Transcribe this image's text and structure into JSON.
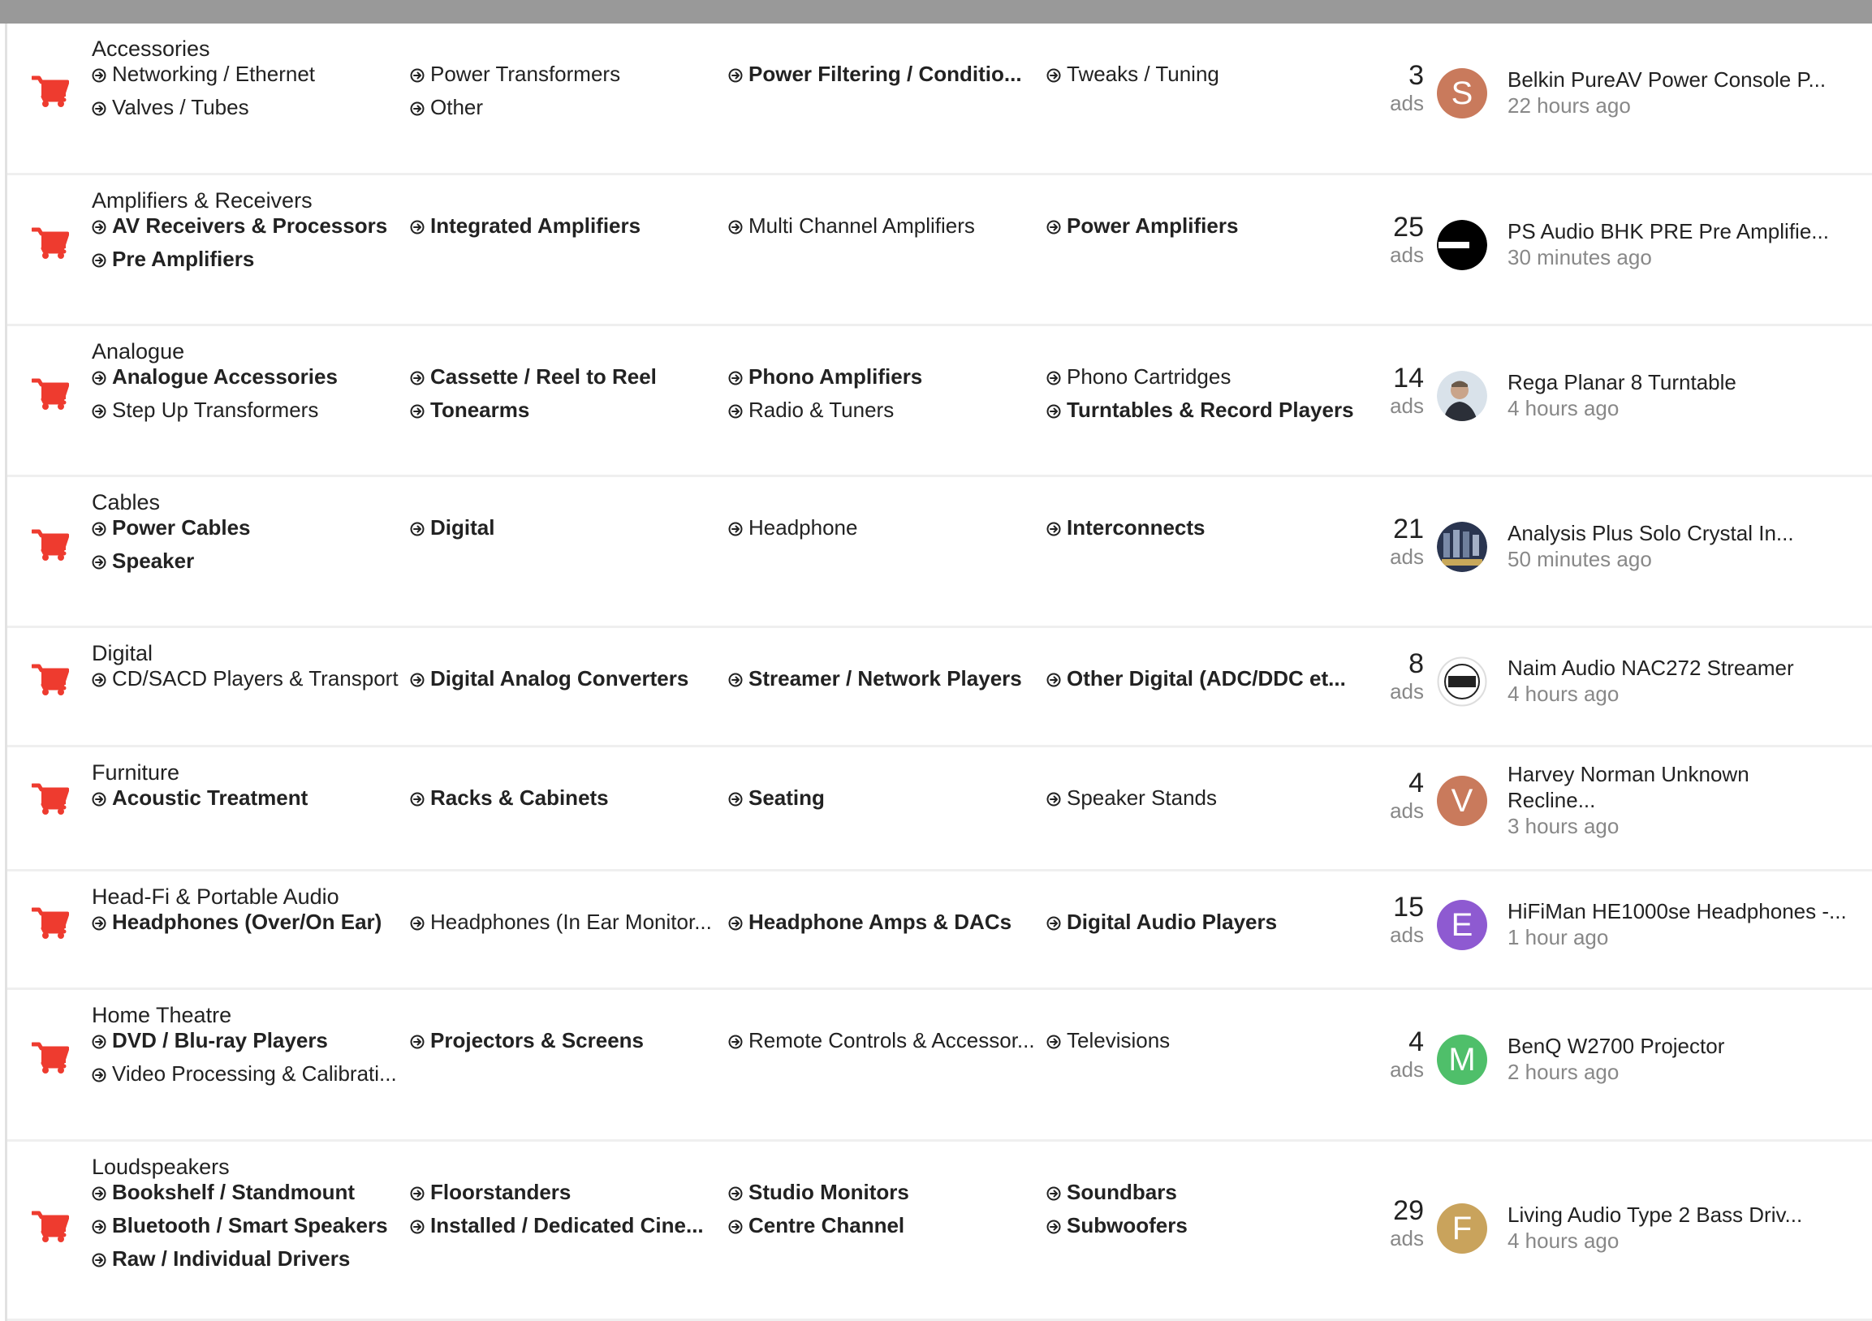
{
  "colors": {
    "cart": "#ee3b2f",
    "avatar_s": "#c97a5c",
    "avatar_v": "#c97a5c",
    "avatar_e": "#8e5ad1",
    "avatar_m": "#4fbf6a",
    "avatar_f": "#c9a35c"
  },
  "categories": [
    {
      "name": "Accessories",
      "subs": [
        {
          "label": "Networking / Ethernet",
          "bold": false
        },
        {
          "label": "Power Transformers",
          "bold": false
        },
        {
          "label": "Power Filtering / Conditio...",
          "bold": true
        },
        {
          "label": "Tweaks / Tuning",
          "bold": false
        },
        {
          "label": "Valves / Tubes",
          "bold": false
        },
        {
          "label": "Other",
          "bold": false
        }
      ],
      "count": "3",
      "ads_label": "ads",
      "avatar": {
        "type": "letter",
        "letter": "S",
        "color_key": "avatar_s"
      },
      "latest_title": "Belkin PureAV Power Console P...",
      "latest_time": "22 hours ago"
    },
    {
      "name": "Amplifiers & Receivers",
      "subs": [
        {
          "label": "AV Receivers & Processors",
          "bold": true
        },
        {
          "label": "Integrated Amplifiers",
          "bold": true
        },
        {
          "label": "Multi Channel Amplifiers",
          "bold": false
        },
        {
          "label": "Power Amplifiers",
          "bold": true
        },
        {
          "label": "Pre Amplifiers",
          "bold": true
        }
      ],
      "count": "25",
      "ads_label": "ads",
      "avatar": {
        "type": "image",
        "image_name": "heynow-logo-avatar"
      },
      "latest_title": "PS Audio BHK PRE Pre Amplifie...",
      "latest_time": "30 minutes ago"
    },
    {
      "name": "Analogue",
      "subs": [
        {
          "label": "Analogue Accessories",
          "bold": true
        },
        {
          "label": "Cassette / Reel to Reel",
          "bold": true
        },
        {
          "label": "Phono Amplifiers",
          "bold": true
        },
        {
          "label": "Phono Cartridges",
          "bold": false
        },
        {
          "label": "Step Up Transformers",
          "bold": false
        },
        {
          "label": "Tonearms",
          "bold": true
        },
        {
          "label": "Radio & Tuners",
          "bold": false
        },
        {
          "label": "Turntables & Record Players",
          "bold": true
        }
      ],
      "count": "14",
      "ads_label": "ads",
      "avatar": {
        "type": "image",
        "image_name": "person-photo-avatar"
      },
      "latest_title": "Rega Planar 8 Turntable",
      "latest_time": "4 hours ago"
    },
    {
      "name": "Cables",
      "subs": [
        {
          "label": "Power Cables",
          "bold": true
        },
        {
          "label": "Digital",
          "bold": true
        },
        {
          "label": "Headphone",
          "bold": false
        },
        {
          "label": "Interconnects",
          "bold": true
        },
        {
          "label": "Speaker",
          "bold": true
        }
      ],
      "count": "21",
      "ads_label": "ads",
      "avatar": {
        "type": "image",
        "image_name": "equipment-photo-avatar"
      },
      "latest_title": "Analysis Plus Solo Crystal In...",
      "latest_time": "50 minutes ago"
    },
    {
      "name": "Digital",
      "subs": [
        {
          "label": "CD/SACD Players & Transport",
          "bold": false
        },
        {
          "label": "Digital Analog Converters",
          "bold": true
        },
        {
          "label": "Streamer / Network Players",
          "bold": true
        },
        {
          "label": "Other Digital (ADC/DDC et...",
          "bold": true
        }
      ],
      "count": "8",
      "ads_label": "ads",
      "avatar": {
        "type": "image",
        "image_name": "len-wallis-audio-logo-avatar"
      },
      "latest_title": "Naim Audio NAC272 Streamer",
      "latest_time": "4 hours ago"
    },
    {
      "name": "Furniture",
      "subs": [
        {
          "label": "Acoustic Treatment",
          "bold": true
        },
        {
          "label": "Racks & Cabinets",
          "bold": true
        },
        {
          "label": "Seating",
          "bold": true
        },
        {
          "label": "Speaker Stands",
          "bold": false
        }
      ],
      "count": "4",
      "ads_label": "ads",
      "avatar": {
        "type": "letter",
        "letter": "V",
        "color_key": "avatar_v"
      },
      "latest_title": "Harvey Norman Unknown Recline...",
      "latest_time": "3 hours ago"
    },
    {
      "name": "Head-Fi & Portable Audio",
      "subs": [
        {
          "label": "Headphones (Over/On Ear)",
          "bold": true
        },
        {
          "label": "Headphones (In Ear Monitor...",
          "bold": false
        },
        {
          "label": "Headphone Amps & DACs",
          "bold": true
        },
        {
          "label": "Digital Audio Players",
          "bold": true
        }
      ],
      "count": "15",
      "ads_label": "ads",
      "avatar": {
        "type": "letter",
        "letter": "E",
        "color_key": "avatar_e"
      },
      "latest_title": "HiFiMan HE1000se Headphones -...",
      "latest_time": "1 hour ago"
    },
    {
      "name": "Home Theatre",
      "subs": [
        {
          "label": "DVD / Blu-ray Players",
          "bold": true
        },
        {
          "label": "Projectors & Screens",
          "bold": true
        },
        {
          "label": "Remote Controls & Accessor...",
          "bold": false
        },
        {
          "label": "Televisions",
          "bold": false
        },
        {
          "label": "Video Processing & Calibrati...",
          "bold": false
        }
      ],
      "count": "4",
      "ads_label": "ads",
      "avatar": {
        "type": "letter",
        "letter": "M",
        "color_key": "avatar_m"
      },
      "latest_title": "BenQ W2700 Projector",
      "latest_time": "2 hours ago"
    },
    {
      "name": "Loudspeakers",
      "subs": [
        {
          "label": "Bookshelf / Standmount",
          "bold": true
        },
        {
          "label": "Floorstanders",
          "bold": true
        },
        {
          "label": "Studio Monitors",
          "bold": true
        },
        {
          "label": "Soundbars",
          "bold": true
        },
        {
          "label": "Bluetooth / Smart Speakers",
          "bold": true
        },
        {
          "label": "Installed / Dedicated Cine...",
          "bold": true
        },
        {
          "label": "Centre Channel",
          "bold": true
        },
        {
          "label": "Subwoofers",
          "bold": true
        },
        {
          "label": "Raw / Individual Drivers",
          "bold": true
        }
      ],
      "count": "29",
      "ads_label": "ads",
      "avatar": {
        "type": "letter",
        "letter": "F",
        "color_key": "avatar_f"
      },
      "latest_title": "Living Audio Type 2 Bass Driv...",
      "latest_time": "4 hours ago"
    }
  ]
}
